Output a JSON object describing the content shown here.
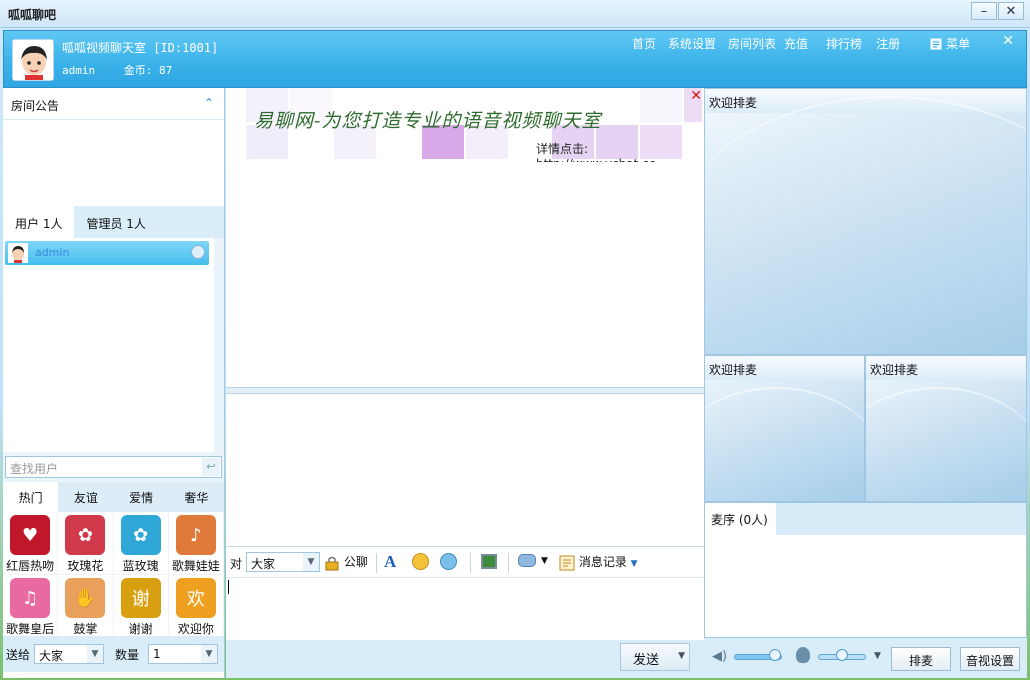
{
  "window": {
    "title": "呱呱聊吧",
    "min": "–",
    "max": "□",
    "close": "✕"
  },
  "header": {
    "room_title": "呱呱视频聊天室 [ID:1001]",
    "username": "admin",
    "coins": "金币: 87",
    "nav": [
      "首页",
      "系统设置",
      "房间列表",
      "充值",
      "排行榜",
      "注册"
    ],
    "menu_label": "菜单",
    "close": "✕"
  },
  "left": {
    "notice_title": "房间公告",
    "user_tabs": [
      "用户 1人",
      "管理员 1人"
    ],
    "users": [
      {
        "name": "admin"
      }
    ],
    "search_placeholder": "查找用户",
    "gift_tabs": [
      "热门",
      "友谊",
      "爱情",
      "奢华"
    ],
    "gifts": [
      {
        "label": "红唇热吻",
        "color": "#c0182a",
        "glyph": "♥"
      },
      {
        "label": "玫瑰花",
        "color": "#d03a4a",
        "glyph": "✿"
      },
      {
        "label": "蓝玫瑰",
        "color": "#2fa8d8",
        "glyph": "✿"
      },
      {
        "label": "歌舞娃娃",
        "color": "#e07a3a",
        "glyph": "♪"
      },
      {
        "label": "歌舞皇后",
        "color": "#e86aa0",
        "glyph": "♫"
      },
      {
        "label": "鼓掌",
        "color": "#e8a05a",
        "glyph": "✋"
      },
      {
        "label": "谢谢",
        "color": "#d8a010",
        "glyph": "谢"
      },
      {
        "label": "欢迎你",
        "color": "#f0a020",
        "glyph": "欢"
      }
    ],
    "send_to_label": "送给",
    "send_to_value": "大家",
    "qty_label": "数量",
    "qty_value": "1"
  },
  "center": {
    "banner_slogan": "易聊网-为您打造专业的语音视频聊天室",
    "banner_detail": "详情点击: http://www.ychat.cc",
    "toolbar": {
      "to_label": "对",
      "to_value": "大家",
      "public_label": "公聊",
      "history_label": "消息记录"
    },
    "send_label": "发送"
  },
  "right": {
    "mic_main": "欢迎排麦",
    "mic_2": "欢迎排麦",
    "mic_3": "欢迎排麦",
    "queue_title": "麦序 (0人)",
    "queue_button": "排麦",
    "av_settings_button": "音视设置",
    "speaker_volume": 0.85,
    "mic_volume": 0.5
  },
  "colors": {
    "header_blue": "#3cb2ea",
    "accent_red": "#e01010"
  }
}
